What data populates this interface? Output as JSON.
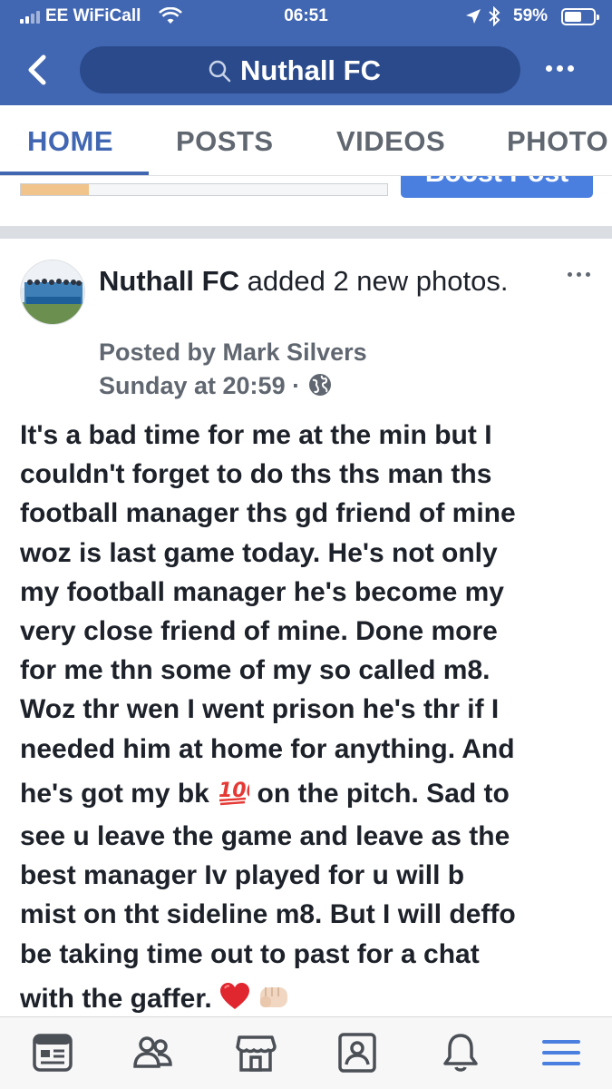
{
  "status_bar": {
    "carrier": "EE WiFiCall",
    "time": "06:51",
    "battery_percent": "59%",
    "battery_level": 0.59
  },
  "header": {
    "search_text": "Nuthall FC"
  },
  "tabs": [
    {
      "label": "HOME",
      "active": true
    },
    {
      "label": "POSTS",
      "active": false
    },
    {
      "label": "VIDEOS",
      "active": false
    },
    {
      "label": "PHOTO",
      "active": false
    }
  ],
  "boost": {
    "button_label": "Boost Post",
    "progress_fraction": 0.185
  },
  "post": {
    "author": "Nuthall FC",
    "action": "added 2 new photos.",
    "posted_by": "Posted by Mark Silvers",
    "timestamp": "Sunday at 20:59 ·",
    "body_lines": [
      "It's a bad time for me at the min but I",
      "couldn't forget to do ths ths man ths",
      "football manager ths gd friend of mine",
      "woz is last game today. He's not only",
      "my football manager he's become my",
      "very close friend of mine.  Done more",
      "for me thn some of my so called m8.",
      "Woz thr wen I went prison he's thr if I",
      "needed him at home for anything.  And"
    ],
    "line10_before": "he's got my bk",
    "line10_after": "on the pitch. Sad to",
    "body_lines_2": [
      "see u leave the game and leave as the",
      "best manager Iv played for u will b",
      "mist on tht sideline m8.  But I will deffo",
      "be taking time out to past for a chat"
    ],
    "last_line": "with the gaffer.",
    "emojis": [
      "hundred-points-emoji",
      "red-heart-emoji",
      "fist-bump-emoji"
    ]
  },
  "bottom_nav": [
    "news-feed-icon",
    "groups-icon",
    "marketplace-icon",
    "profile-icon",
    "notifications-icon",
    "menu-icon"
  ],
  "colors": {
    "brand_blue": "#4267b2",
    "search_bg": "#2a4a8c",
    "text": "#1d2129",
    "secondary_text": "#606770"
  }
}
